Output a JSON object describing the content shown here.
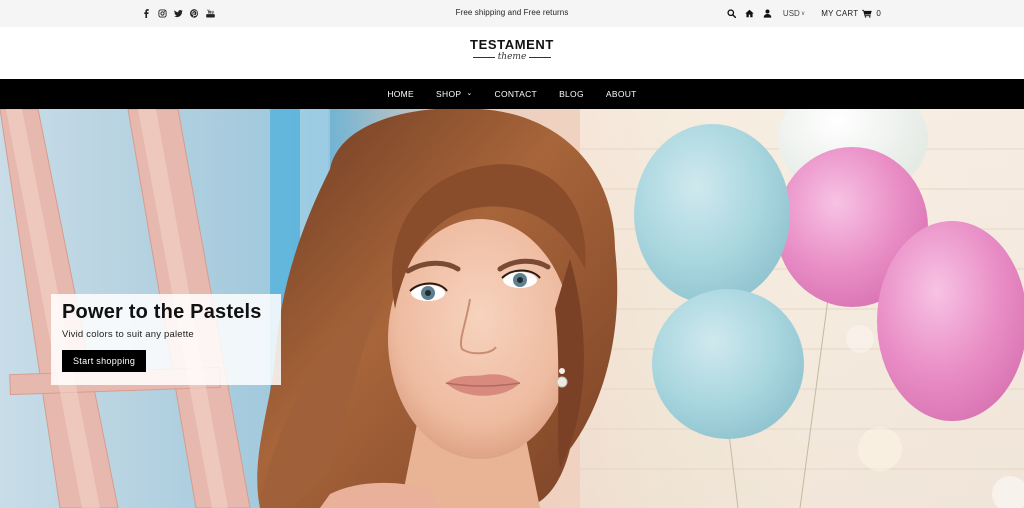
{
  "topbar": {
    "social_icons": [
      "facebook-icon",
      "instagram-icon",
      "twitter-icon",
      "pinterest-icon",
      "youtube-icon"
    ],
    "promo_text": "Free shipping and Free returns",
    "utility_icons": [
      "search-icon",
      "home-icon",
      "user-icon"
    ],
    "currency": "USD",
    "cart_label": "MY CART",
    "cart_count": "0"
  },
  "logo": {
    "main": "TESTAMENT",
    "sub": "theme"
  },
  "nav": {
    "items": [
      {
        "label": "HOME"
      },
      {
        "label": "SHOP",
        "has_dropdown": true
      },
      {
        "label": "CONTACT"
      },
      {
        "label": "BLOG"
      },
      {
        "label": "ABOUT"
      }
    ]
  },
  "hero": {
    "title": "Power to the Pastels",
    "subtitle": "Vivid colors to suit any palette",
    "button_label": "Start shopping",
    "image": "woman-with-pastel-balloons",
    "colors": {
      "balloon_blue": "#a9d6df",
      "balloon_pink": "#e98dc6",
      "balloon_white": "#eef0ea",
      "hair": "#9a5a35",
      "wall_blue": "#6fb3d3",
      "ladder_pink": "#e7b8ad"
    }
  },
  "colors": {
    "topbar_bg": "#f5f5f5",
    "nav_bg": "#000000",
    "nav_text": "#ffffff",
    "button_bg": "#000000"
  }
}
